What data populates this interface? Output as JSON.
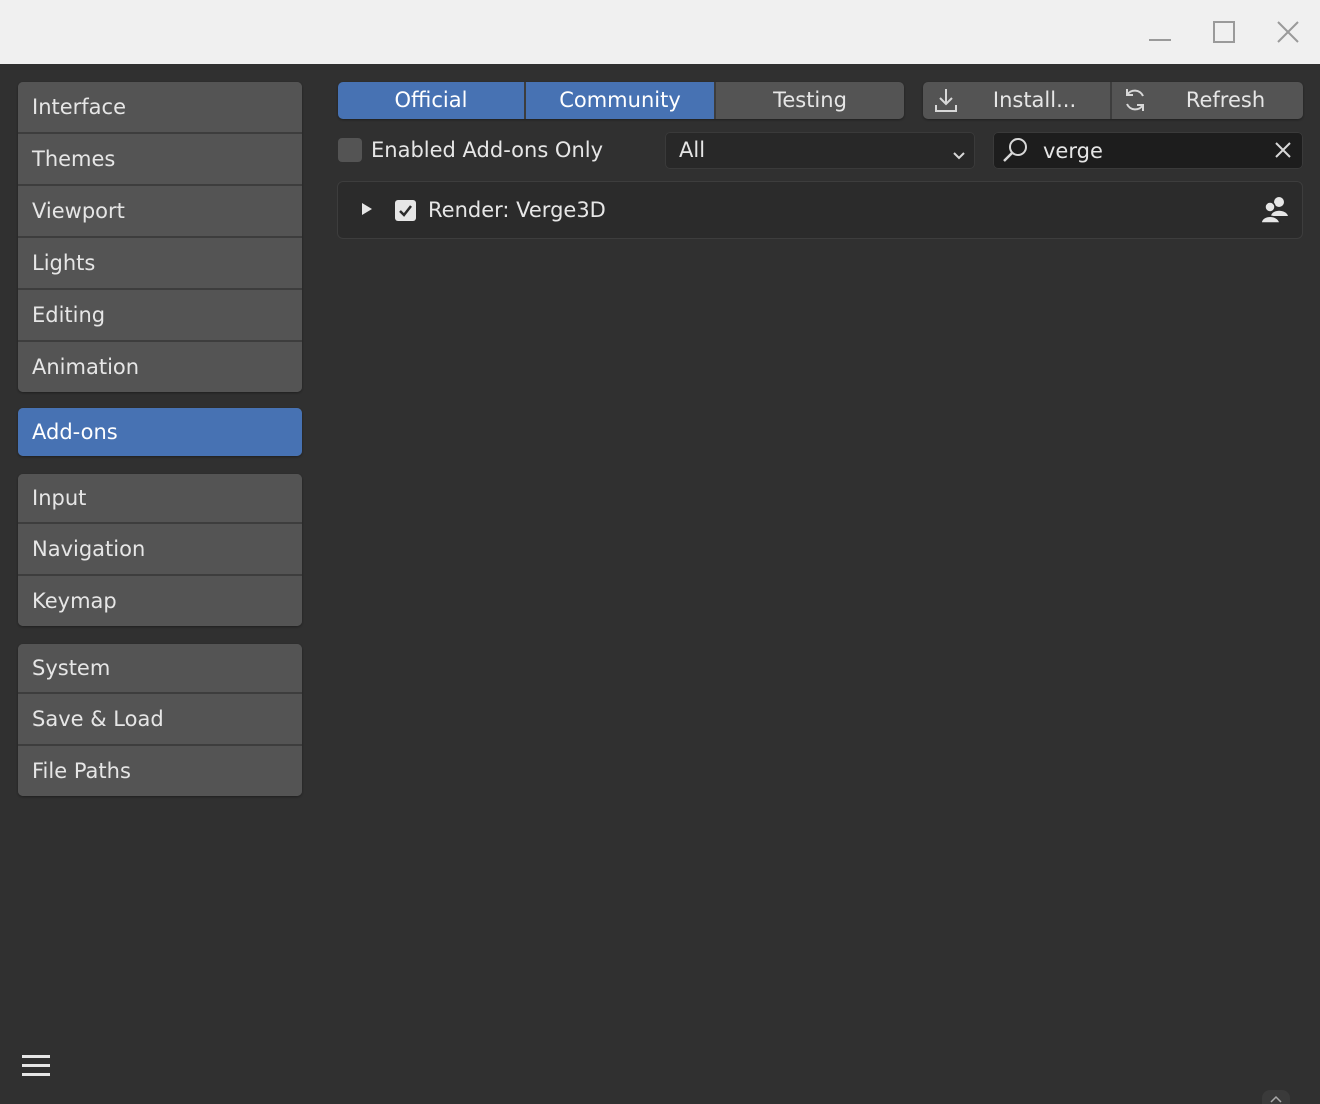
{
  "titlebar": {
    "controls": [
      "minimize",
      "maximize",
      "close"
    ]
  },
  "sidebar": {
    "groups": [
      {
        "items": [
          "Interface",
          "Themes",
          "Viewport",
          "Lights",
          "Editing",
          "Animation"
        ]
      },
      {
        "items": [
          "Add-ons"
        ]
      },
      {
        "items": [
          "Input",
          "Navigation",
          "Keymap"
        ]
      },
      {
        "items": [
          "System",
          "Save & Load",
          "File Paths"
        ]
      }
    ],
    "active": "Add-ons"
  },
  "tabs": {
    "official": "Official",
    "community": "Community",
    "testing": "Testing",
    "install": "Install...",
    "refresh": "Refresh"
  },
  "filters": {
    "enabled_only_label": "Enabled Add-ons Only",
    "enabled_only_checked": false,
    "category": "All",
    "search_value": "verge"
  },
  "addons": [
    {
      "name": "Render: Verge3D",
      "enabled": true
    }
  ],
  "colors": {
    "accent": "#4772b3",
    "panel": "#303030",
    "button": "#545454"
  }
}
